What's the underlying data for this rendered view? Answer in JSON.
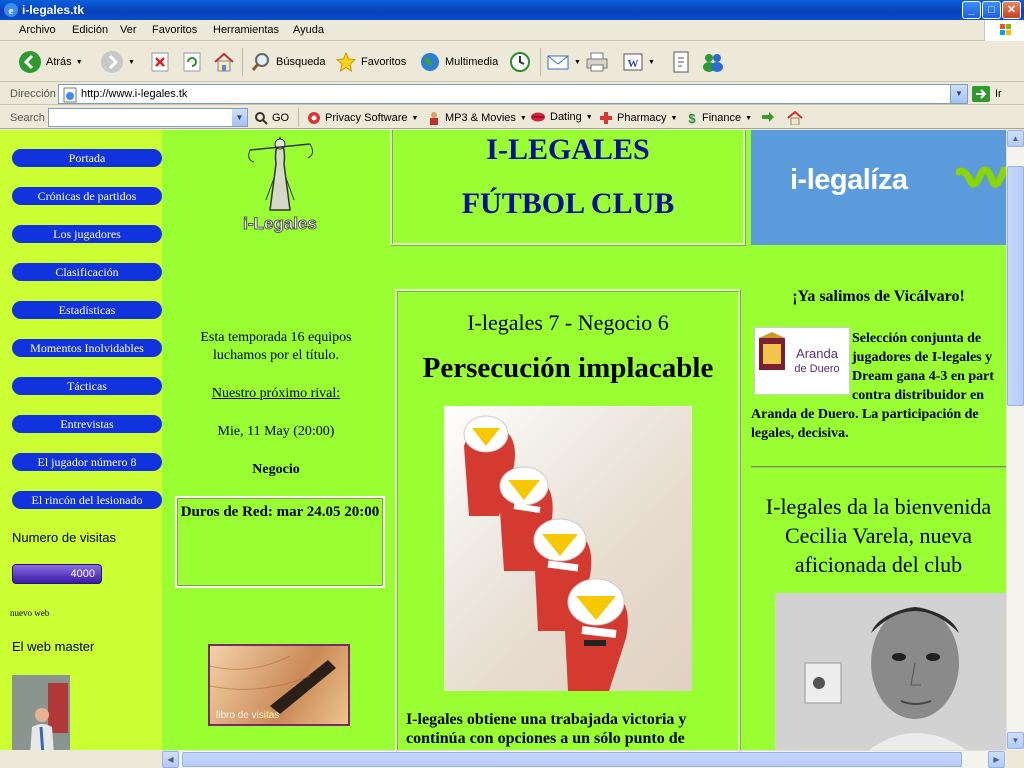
{
  "window": {
    "title": "i-legales.tk"
  },
  "menu": [
    {
      "label": "Archivo"
    },
    {
      "label": "Edición"
    },
    {
      "label": "Ver"
    },
    {
      "label": "Favoritos"
    },
    {
      "label": "Herramientas"
    },
    {
      "label": "Ayuda"
    }
  ],
  "toolbar": {
    "back": "Atrás",
    "search": "Búsqueda",
    "favorites": "Favoritos",
    "media": "Multimedia"
  },
  "address": {
    "label": "Dirección",
    "url": "http://www.i-legales.tk",
    "go": "Ir"
  },
  "searchbar": {
    "label": "Search",
    "go": "GO",
    "items": [
      {
        "label": "Privacy Software"
      },
      {
        "label": "MP3 & Movies"
      },
      {
        "label": "Dating"
      },
      {
        "label": "Pharmacy"
      },
      {
        "label": "Finance"
      }
    ]
  },
  "nav": [
    {
      "label": "Portada"
    },
    {
      "label": "Crónicas de partidos"
    },
    {
      "label": "Los jugadores"
    },
    {
      "label": "Clasificación"
    },
    {
      "label": "Estadísticas"
    },
    {
      "label": "Momentos Inolvidables"
    },
    {
      "label": "Tácticas"
    },
    {
      "label": "Entrevistas"
    },
    {
      "label": "El jugador número 8"
    },
    {
      "label": "El rincón del lesionado"
    }
  ],
  "sidebar": {
    "visits_label": "Numero de visitas",
    "visits_count": "4000",
    "nuevo_web": "nuevo web",
    "webmaster_label": "El web master"
  },
  "col2": {
    "logo_text": "i-Legales",
    "season_line1": "Esta temporada 16 equipos",
    "season_line2": "luchamos por el título.",
    "next_rival_label": "Nuestro próximo rival:",
    "next_date": "Mie, 11 May (20:00)",
    "next_team": "Negocio",
    "box_text": "Duros de Red: mar 24.05 20:00",
    "guestbook": "libro de visitas"
  },
  "header": {
    "line1": "I-LEGALES",
    "line2": "FÚTBOL CLUB"
  },
  "article": {
    "score": "I-legales 7 - Negocio 6",
    "headline": "Persecución implacable",
    "body": "I-legales obtiene una trabajada victoria y continúa con opciones a un sólo punto de"
  },
  "right": {
    "banner_text": "i-legalíza",
    "vicalvaro": "¡Ya salimos de Vicálvaro!",
    "aranda_logo_line1": "Aranda",
    "aranda_logo_line2": "de Duero",
    "news_l1": "Selección conjunta de",
    "news_l2": "jugadores de I-legales y",
    "news_l3": "Dream gana 4-3 en part",
    "news_l4": "contra distribuidor en",
    "news_l5": "Aranda de Duero. La participación de",
    "news_l6": "legales, decisiva.",
    "welcome_l1": "I-legales da la bienvenida",
    "welcome_l2": "Cecilia Varela, nueva",
    "welcome_l3": "aficionada del club"
  },
  "colors": {
    "page_green": "#99ff33",
    "nav_green": "#ccff33",
    "nav_button": "#1133dd",
    "header_blue": "#000f99",
    "xp_title": "#0841b8"
  }
}
